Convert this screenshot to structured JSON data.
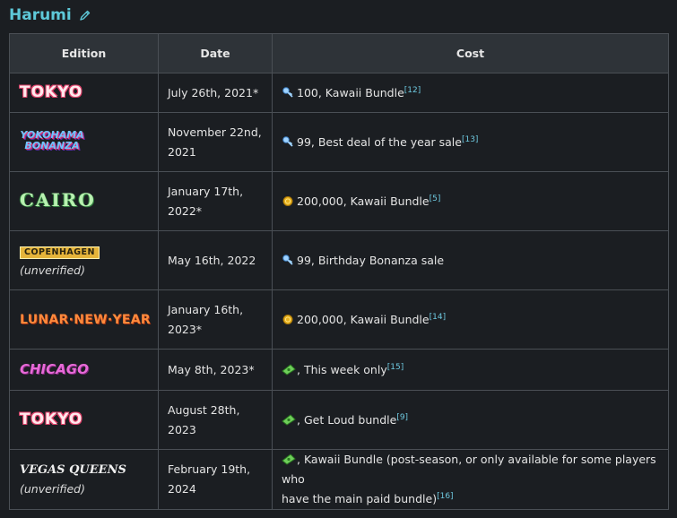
{
  "heading": {
    "title": "Harumi"
  },
  "table": {
    "headers": {
      "edition": "Edition",
      "date": "Date",
      "cost": "Cost"
    },
    "rows": [
      {
        "edition_logo": "TOKYO",
        "edition_note": "",
        "date_line1": "July 26th, 2021*",
        "date_line2": "",
        "currency": "bucks-key-icon",
        "cost_text": "100, Kawaii Bundle",
        "cost_line2": "",
        "ref": "[12]"
      },
      {
        "edition_logo": "YOKOHAMA BONANZA",
        "edition_note": "",
        "date_line1": "November 22nd,",
        "date_line2": "2021",
        "currency": "bucks-key-icon",
        "cost_text": "99, Best deal of the year sale",
        "cost_line2": "",
        "ref": "[13]"
      },
      {
        "edition_logo": "CAIRO",
        "edition_note": "",
        "date_line1": "January 17th,",
        "date_line2": "2022*",
        "currency": "coin-icon",
        "cost_text": "200,000, Kawaii Bundle",
        "cost_line2": "",
        "ref": "[5]"
      },
      {
        "edition_logo": "COPENHAGEN",
        "edition_note": "(unverified)",
        "date_line1": "May 16th, 2022",
        "date_line2": "",
        "currency": "bucks-key-icon",
        "cost_text": "99, Birthday Bonanza sale",
        "cost_line2": "",
        "ref": ""
      },
      {
        "edition_logo": "LUNAR·NEW·YEAR",
        "edition_note": "",
        "date_line1": "January 16th,",
        "date_line2": "2023*",
        "currency": "coin-icon",
        "cost_text": "200,000, Kawaii Bundle",
        "cost_line2": "",
        "ref": "[14]"
      },
      {
        "edition_logo": "CHICAGO",
        "edition_note": "",
        "date_line1": "May 8th, 2023*",
        "date_line2": "",
        "currency": "cash-icon",
        "cost_text": ", This week only",
        "cost_line2": "",
        "ref": "[15]"
      },
      {
        "edition_logo": "TOKYO",
        "edition_note": "",
        "date_line1": "August 28th,",
        "date_line2": "2023",
        "currency": "cash-icon",
        "cost_text": ", Get Loud bundle",
        "cost_line2": "",
        "ref": "[9]"
      },
      {
        "edition_logo": "VEGAS QUEENS",
        "edition_note": "(unverified)",
        "date_line1": "February 19th,",
        "date_line2": "2024",
        "currency": "cash-icon",
        "cost_text": ", Kawaii Bundle (post-season, or only available for some players who",
        "cost_line2": "have the main paid bundle)",
        "ref": "[16]"
      }
    ]
  },
  "colors": {
    "heading": "#5ec8d8",
    "link": "#6ec9e0",
    "border": "#4a4f55",
    "header_bg": "#2e3338",
    "bg": "#1b1e22"
  }
}
